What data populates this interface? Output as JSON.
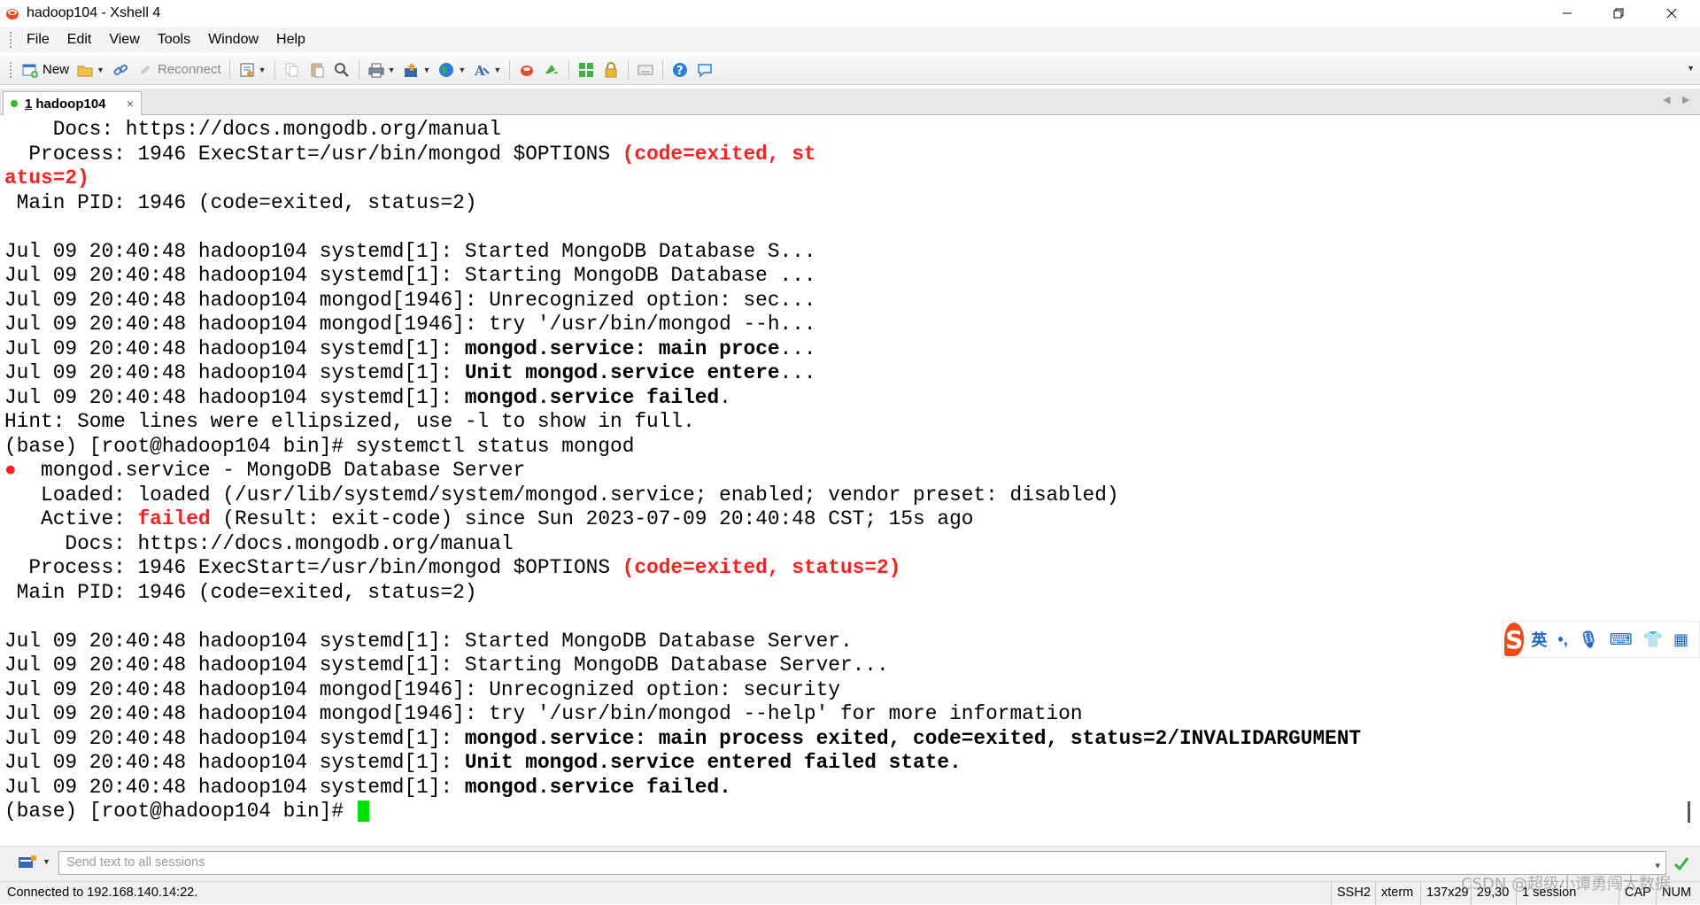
{
  "window": {
    "title": "hadoop104 - Xshell 4",
    "controls": [
      "minimize",
      "restore",
      "close"
    ]
  },
  "menu": [
    "File",
    "Edit",
    "View",
    "Tools",
    "Window",
    "Help"
  ],
  "toolbar": {
    "new_label": "New",
    "reconnect_label": "Reconnect"
  },
  "tab": {
    "number": "1",
    "label": "hadoop104",
    "close": "×",
    "status_color": "#2bbd2b"
  },
  "terminal": {
    "cursor_color": "#00e000",
    "error_color": "#ff2020",
    "lines": [
      [
        {
          "t": "    Docs: https://docs.mongodb.org/manual"
        }
      ],
      [
        {
          "t": "  Process: 1946 ExecStart=/usr/bin/mongod $OPTIONS "
        },
        {
          "t": "(code=exited, st",
          "s": "r"
        }
      ],
      [
        {
          "t": "atus=2)",
          "s": "r"
        }
      ],
      [
        {
          "t": " Main PID: 1946 (code=exited, status=2)"
        }
      ],
      [
        {
          "t": ""
        }
      ],
      [
        {
          "t": "Jul 09 20:40:48 hadoop104 systemd[1]: Started MongoDB Database S..."
        }
      ],
      [
        {
          "t": "Jul 09 20:40:48 hadoop104 systemd[1]: Starting MongoDB Database ..."
        }
      ],
      [
        {
          "t": "Jul 09 20:40:48 hadoop104 mongod[1946]: Unrecognized option: sec..."
        }
      ],
      [
        {
          "t": "Jul 09 20:40:48 hadoop104 mongod[1946]: try '/usr/bin/mongod --h..."
        }
      ],
      [
        {
          "t": "Jul 09 20:40:48 hadoop104 systemd[1]: "
        },
        {
          "t": "mongod.service: main proce",
          "s": "b"
        },
        {
          "t": "..."
        }
      ],
      [
        {
          "t": "Jul 09 20:40:48 hadoop104 systemd[1]: "
        },
        {
          "t": "Unit mongod.service entere",
          "s": "b"
        },
        {
          "t": "..."
        }
      ],
      [
        {
          "t": "Jul 09 20:40:48 hadoop104 systemd[1]: "
        },
        {
          "t": "mongod.service failed",
          "s": "b"
        },
        {
          "t": "."
        }
      ],
      [
        {
          "t": "Hint: Some lines were ellipsized, use -l to show in full."
        }
      ],
      [
        {
          "t": "(base) [root@hadoop104 bin]# systemctl status mongod"
        }
      ],
      [
        {
          "t": "●",
          "s": "rdot"
        },
        {
          "t": "  mongod.service - MongoDB Database Server"
        }
      ],
      [
        {
          "t": "   Loaded: loaded (/usr/lib/systemd/system/mongod.service; enabled; vendor preset: disabled)"
        }
      ],
      [
        {
          "t": "   Active: "
        },
        {
          "t": "failed",
          "s": "r"
        },
        {
          "t": " (Result: exit-code) since Sun 2023-07-09 20:40:48 CST; 15s ago"
        }
      ],
      [
        {
          "t": "     Docs: https://docs.mongodb.org/manual"
        }
      ],
      [
        {
          "t": "  Process: 1946 ExecStart=/usr/bin/mongod $OPTIONS "
        },
        {
          "t": "(code=exited, status=2)",
          "s": "r"
        }
      ],
      [
        {
          "t": " Main PID: 1946 (code=exited, status=2)"
        }
      ],
      [
        {
          "t": ""
        }
      ],
      [
        {
          "t": "Jul 09 20:40:48 hadoop104 systemd[1]: Started MongoDB Database Server."
        }
      ],
      [
        {
          "t": "Jul 09 20:40:48 hadoop104 systemd[1]: Starting MongoDB Database Server..."
        }
      ],
      [
        {
          "t": "Jul 09 20:40:48 hadoop104 mongod[1946]: Unrecognized option: security"
        }
      ],
      [
        {
          "t": "Jul 09 20:40:48 hadoop104 mongod[1946]: try '/usr/bin/mongod --help' for more information"
        }
      ],
      [
        {
          "t": "Jul 09 20:40:48 hadoop104 systemd[1]: "
        },
        {
          "t": "mongod.service: main process exited, code=exited, status=2/INVALIDARGUMENT",
          "s": "b"
        }
      ],
      [
        {
          "t": "Jul 09 20:40:48 hadoop104 systemd[1]: "
        },
        {
          "t": "Unit mongod.service entered failed state.",
          "s": "b"
        }
      ],
      [
        {
          "t": "Jul 09 20:40:48 hadoop104 systemd[1]: "
        },
        {
          "t": "mongod.service failed.",
          "s": "b"
        }
      ],
      [
        {
          "t": "(base) [root@hadoop104 bin]# "
        },
        {
          "t": "",
          "s": "cursor"
        }
      ]
    ]
  },
  "ime": {
    "logo": "S",
    "items": [
      "英",
      "•,",
      "🎙",
      "⌨",
      "👕",
      "▦"
    ]
  },
  "sendbar": {
    "placeholder": "Send text to all sessions"
  },
  "statusbar": {
    "connection": "Connected to 192.168.140.14:22.",
    "protocol": "SSH2",
    "term": "xterm",
    "size": "137x29",
    "cursor_pos": "29,30",
    "sessions": "1 session",
    "caps": "CAP",
    "num": "NUM"
  },
  "watermark": "CSDN @超级小谭勇闯大数据"
}
